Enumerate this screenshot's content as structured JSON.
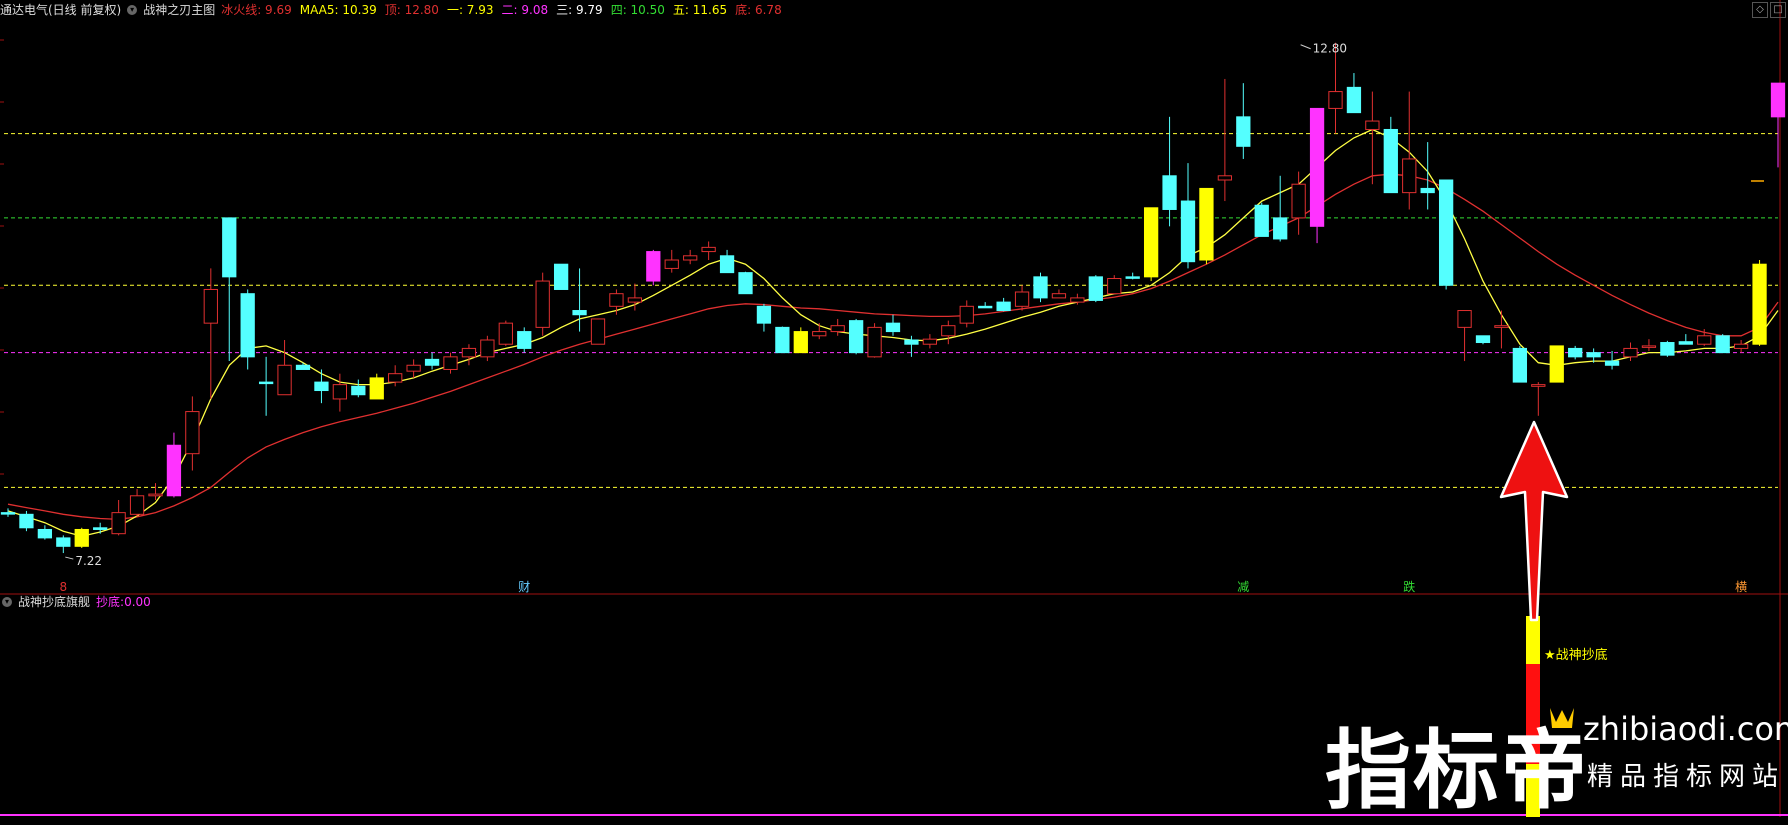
{
  "header": {
    "stock": "通达电气(日线 前复权)",
    "indicator_name": "战神之刃主图",
    "values": [
      {
        "label": "冰火线:",
        "value": "9.69",
        "color": "#e03030"
      },
      {
        "label": "MAA5:",
        "value": "10.39",
        "color": "#ffff00"
      },
      {
        "label": "顶:",
        "value": "12.80",
        "color": "#e03030"
      },
      {
        "label": "一:",
        "value": "7.93",
        "color": "#ffff00"
      },
      {
        "label": "二:",
        "value": "9.08",
        "color": "#ff33ff"
      },
      {
        "label": "三:",
        "value": "9.79",
        "color": "#ffffff"
      },
      {
        "label": "四:",
        "value": "10.50",
        "color": "#33dd33"
      },
      {
        "label": "五:",
        "value": "11.65",
        "color": "#ffff00"
      },
      {
        "label": "底:",
        "value": "6.78",
        "color": "#e03030"
      }
    ]
  },
  "subheader": {
    "indicator_name": "战神抄底旗舰",
    "label": "抄底:",
    "value": "0.00",
    "color": "#ff33ff"
  },
  "chart_data": {
    "type": "candlestick",
    "price_range": [
      6.8,
      13.45
    ],
    "high_label": "12.80",
    "low_label": "7.22",
    "markers": [
      {
        "index": 3,
        "text": "8",
        "color": "#e03030"
      },
      {
        "index": 28,
        "text": "财",
        "color": "#66ccff"
      },
      {
        "index": 67,
        "text": "减",
        "color": "#33dd33"
      },
      {
        "index": 76,
        "text": "跌",
        "color": "#33dd33"
      },
      {
        "index": 94,
        "text": "横",
        "color": "#ff9933"
      }
    ],
    "hlines": [
      {
        "price": 12.1,
        "color": "#ffff33"
      },
      {
        "price": 11.1,
        "color": "#33dd33"
      },
      {
        "price": 10.3,
        "color": "#ffff33"
      },
      {
        "price": 9.5,
        "color": "#ff33ff"
      },
      {
        "price": 7.9,
        "color": "#ffff33"
      }
    ],
    "signal_label": "★战神抄底",
    "candles": [
      [
        7.6,
        7.65,
        7.55,
        7.6,
        "c"
      ],
      [
        7.58,
        7.62,
        7.38,
        7.42,
        "c"
      ],
      [
        7.4,
        7.45,
        7.28,
        7.3,
        "c"
      ],
      [
        7.3,
        7.33,
        7.12,
        7.2,
        "c"
      ],
      [
        7.2,
        7.42,
        7.18,
        7.4,
        "y"
      ],
      [
        7.4,
        7.48,
        7.35,
        7.42,
        "c"
      ],
      [
        7.35,
        7.75,
        7.33,
        7.6,
        "r"
      ],
      [
        7.58,
        7.88,
        7.55,
        7.8,
        "r"
      ],
      [
        7.8,
        7.95,
        7.75,
        7.82,
        "r"
      ],
      [
        7.8,
        8.55,
        7.78,
        8.4,
        "m"
      ],
      [
        8.3,
        8.98,
        8.1,
        8.8,
        "r"
      ],
      [
        9.85,
        10.5,
        8.95,
        10.25,
        "r"
      ],
      [
        11.1,
        11.1,
        9.4,
        10.4,
        "c"
      ],
      [
        10.2,
        10.25,
        9.3,
        9.45,
        "c"
      ],
      [
        9.15,
        9.45,
        8.75,
        9.15,
        "c"
      ],
      [
        9.0,
        9.65,
        9.0,
        9.35,
        "r"
      ],
      [
        9.35,
        9.38,
        9.3,
        9.3,
        "c"
      ],
      [
        9.15,
        9.3,
        8.9,
        9.05,
        "c"
      ],
      [
        8.95,
        9.25,
        8.8,
        9.12,
        "r"
      ],
      [
        9.1,
        9.18,
        8.97,
        9.0,
        "c"
      ],
      [
        8.95,
        9.25,
        8.95,
        9.2,
        "y"
      ],
      [
        9.15,
        9.35,
        9.1,
        9.25,
        "r"
      ],
      [
        9.28,
        9.42,
        9.2,
        9.35,
        "r"
      ],
      [
        9.35,
        9.5,
        9.3,
        9.42,
        "c"
      ],
      [
        9.3,
        9.5,
        9.25,
        9.45,
        "r"
      ],
      [
        9.45,
        9.6,
        9.35,
        9.55,
        "r"
      ],
      [
        9.45,
        9.7,
        9.4,
        9.65,
        "r"
      ],
      [
        9.85,
        9.88,
        9.58,
        9.6,
        "r"
      ],
      [
        9.55,
        9.8,
        9.5,
        9.75,
        "c"
      ],
      [
        9.8,
        10.45,
        9.7,
        10.35,
        "r"
      ],
      [
        10.55,
        10.55,
        10.25,
        10.25,
        "c"
      ],
      [
        10.0,
        10.5,
        9.75,
        9.95,
        "c"
      ],
      [
        9.6,
        9.9,
        9.6,
        9.9,
        "r"
      ],
      [
        10.2,
        10.25,
        9.95,
        10.05,
        "r"
      ],
      [
        10.1,
        10.32,
        10.0,
        10.15,
        "r"
      ],
      [
        10.7,
        10.72,
        10.3,
        10.35,
        "m"
      ],
      [
        10.5,
        10.72,
        10.45,
        10.6,
        "r"
      ],
      [
        10.6,
        10.72,
        10.55,
        10.65,
        "r"
      ],
      [
        10.7,
        10.82,
        10.6,
        10.75,
        "r"
      ],
      [
        10.65,
        10.72,
        10.45,
        10.45,
        "c"
      ],
      [
        10.45,
        10.46,
        10.25,
        10.2,
        "c"
      ],
      [
        10.05,
        10.08,
        9.75,
        9.85,
        "c"
      ],
      [
        9.8,
        9.81,
        9.5,
        9.5,
        "c"
      ],
      [
        9.5,
        9.8,
        9.5,
        9.75,
        "y"
      ],
      [
        9.7,
        9.85,
        9.66,
        9.75,
        "r"
      ],
      [
        9.75,
        9.9,
        9.7,
        9.82,
        "r"
      ],
      [
        9.88,
        9.9,
        9.48,
        9.5,
        "c"
      ],
      [
        9.45,
        9.85,
        9.44,
        9.8,
        "r"
      ],
      [
        9.85,
        9.95,
        9.7,
        9.75,
        "c"
      ],
      [
        9.65,
        9.7,
        9.45,
        9.6,
        "c"
      ],
      [
        9.6,
        9.72,
        9.55,
        9.66,
        "r"
      ],
      [
        9.7,
        9.88,
        9.6,
        9.82,
        "r"
      ],
      [
        9.85,
        10.12,
        9.8,
        10.05,
        "r"
      ],
      [
        10.05,
        10.1,
        10.03,
        10.04,
        "c"
      ],
      [
        10.1,
        10.15,
        9.99,
        10.0,
        "c"
      ],
      [
        10.05,
        10.3,
        10.0,
        10.22,
        "r"
      ],
      [
        10.4,
        10.45,
        10.1,
        10.15,
        "c"
      ],
      [
        10.15,
        10.25,
        10.15,
        10.2,
        "r"
      ],
      [
        10.1,
        10.2,
        10.07,
        10.15,
        "r"
      ],
      [
        10.4,
        10.42,
        10.1,
        10.12,
        "c"
      ],
      [
        10.2,
        10.42,
        10.2,
        10.38,
        "r"
      ],
      [
        10.4,
        10.45,
        10.37,
        10.4,
        "c"
      ],
      [
        10.4,
        11.22,
        10.35,
        11.22,
        "y"
      ],
      [
        11.6,
        12.3,
        11.0,
        11.2,
        "c"
      ],
      [
        11.3,
        11.75,
        10.5,
        10.58,
        "c"
      ],
      [
        10.6,
        11.42,
        10.55,
        11.45,
        "y"
      ],
      [
        11.55,
        12.75,
        11.3,
        11.6,
        "r"
      ],
      [
        12.3,
        12.7,
        11.8,
        11.95,
        "c"
      ],
      [
        11.25,
        11.28,
        10.92,
        10.88,
        "c"
      ],
      [
        10.85,
        11.6,
        10.82,
        11.1,
        "c"
      ],
      [
        11.1,
        11.65,
        10.9,
        11.5,
        "r"
      ],
      [
        11.0,
        12.4,
        10.8,
        12.4,
        "m"
      ],
      [
        12.4,
        13.18,
        12.1,
        12.6,
        "r"
      ],
      [
        12.65,
        12.82,
        12.35,
        12.35,
        "c"
      ],
      [
        12.25,
        12.6,
        11.5,
        12.15,
        "r"
      ],
      [
        12.15,
        12.3,
        11.4,
        11.4,
        "c"
      ],
      [
        11.4,
        12.6,
        11.2,
        11.8,
        "r"
      ],
      [
        11.45,
        12.0,
        11.2,
        11.4,
        "c"
      ],
      [
        11.55,
        11.55,
        10.25,
        10.3,
        "c"
      ],
      [
        9.8,
        10.0,
        9.4,
        10.0,
        "r"
      ],
      [
        9.7,
        9.7,
        9.6,
        9.62,
        "c"
      ],
      [
        9.8,
        10.0,
        9.55,
        9.82,
        "r"
      ],
      [
        9.55,
        9.58,
        9.18,
        9.15,
        "c"
      ],
      [
        9.12,
        9.15,
        8.75,
        9.1,
        "r"
      ],
      [
        9.15,
        9.58,
        9.15,
        9.58,
        "y"
      ],
      [
        9.55,
        9.58,
        9.42,
        9.45,
        "c"
      ],
      [
        9.45,
        9.55,
        9.38,
        9.5,
        "c"
      ],
      [
        9.4,
        9.52,
        9.3,
        9.35,
        "c"
      ],
      [
        9.45,
        9.62,
        9.4,
        9.55,
        "r"
      ],
      [
        9.58,
        9.66,
        9.52,
        9.58,
        "r"
      ],
      [
        9.62,
        9.64,
        9.45,
        9.47,
        "c"
      ],
      [
        9.6,
        9.72,
        9.6,
        9.63,
        "c"
      ],
      [
        9.6,
        9.78,
        9.58,
        9.7,
        "r"
      ],
      [
        9.7,
        9.72,
        9.52,
        9.5,
        "c"
      ],
      [
        9.55,
        9.65,
        9.5,
        9.6,
        "r"
      ],
      [
        9.6,
        10.6,
        9.58,
        10.55,
        "y"
      ],
      [
        12.3,
        12.7,
        11.7,
        12.7,
        "m"
      ]
    ],
    "ma_yellow": [
      7.62,
      7.55,
      7.48,
      7.38,
      7.32,
      7.37,
      7.44,
      7.56,
      7.72,
      8.02,
      8.45,
      8.95,
      9.35,
      9.55,
      9.58,
      9.5,
      9.38,
      9.25,
      9.15,
      9.12,
      9.12,
      9.15,
      9.2,
      9.28,
      9.35,
      9.42,
      9.5,
      9.55,
      9.6,
      9.68,
      9.8,
      9.9,
      9.95,
      10.0,
      10.07,
      10.18,
      10.3,
      10.42,
      10.55,
      10.62,
      10.55,
      10.38,
      10.15,
      9.95,
      9.82,
      9.75,
      9.72,
      9.7,
      9.68,
      9.65,
      9.64,
      9.67,
      9.72,
      9.78,
      9.85,
      9.92,
      9.98,
      10.05,
      10.1,
      10.15,
      10.2,
      10.22,
      10.3,
      10.45,
      10.65,
      10.75,
      10.9,
      11.1,
      11.3,
      11.4,
      11.5,
      11.7,
      11.9,
      12.05,
      12.15,
      12.05,
      11.88,
      11.65,
      11.3,
      10.85,
      10.35,
      9.95,
      9.6,
      9.38,
      9.35,
      9.38,
      9.4,
      9.4,
      9.45,
      9.5,
      9.5,
      9.52,
      9.55,
      9.55,
      9.58,
      9.7,
      10.0
    ],
    "ma_red": [
      7.7,
      7.66,
      7.62,
      7.58,
      7.55,
      7.53,
      7.52,
      7.55,
      7.6,
      7.68,
      7.78,
      7.9,
      8.08,
      8.25,
      8.38,
      8.47,
      8.55,
      8.62,
      8.68,
      8.73,
      8.78,
      8.84,
      8.9,
      8.97,
      9.04,
      9.12,
      9.2,
      9.28,
      9.36,
      9.45,
      9.53,
      9.6,
      9.66,
      9.72,
      9.78,
      9.84,
      9.9,
      9.96,
      10.02,
      10.06,
      10.08,
      10.07,
      10.05,
      10.03,
      10.02,
      10.0,
      9.98,
      9.96,
      9.95,
      9.94,
      9.93,
      9.93,
      9.94,
      9.96,
      9.99,
      10.02,
      10.05,
      10.08,
      10.1,
      10.13,
      10.16,
      10.2,
      10.26,
      10.35,
      10.45,
      10.55,
      10.66,
      10.78,
      10.9,
      11.0,
      11.1,
      11.24,
      11.38,
      11.5,
      11.6,
      11.62,
      11.6,
      11.55,
      11.45,
      11.32,
      11.18,
      11.02,
      10.86,
      10.7,
      10.55,
      10.42,
      10.3,
      10.18,
      10.07,
      9.97,
      9.88,
      9.8,
      9.74,
      9.7,
      9.7,
      9.8,
      10.1
    ]
  },
  "watermark": {
    "big": "指标帝",
    "url": "zhibiaodi.com",
    "sub": "精品指标网站"
  }
}
